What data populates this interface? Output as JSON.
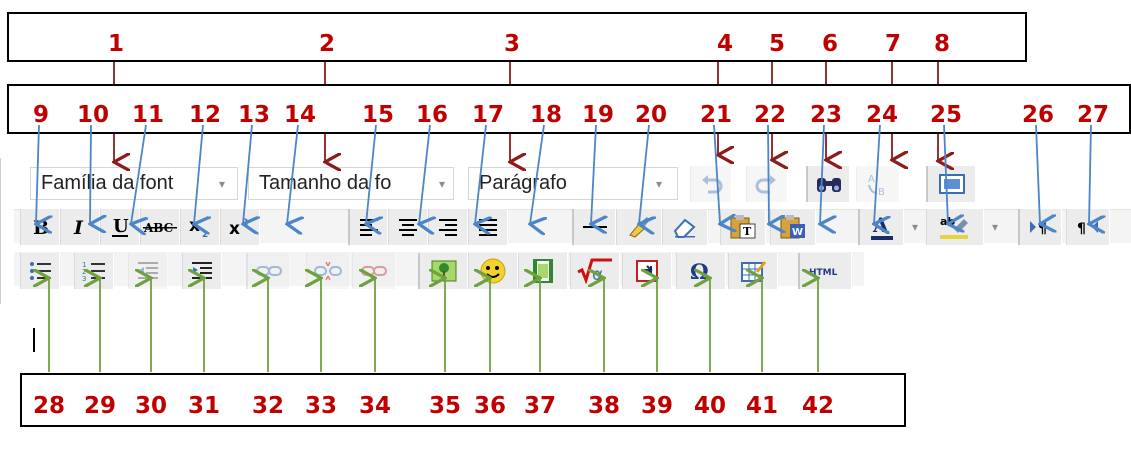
{
  "toolbar": {
    "font_family_label": "Família da font",
    "font_size_label": "Tamanho da fo",
    "paragraph_label": "Parágrafo",
    "dropdown_arrow": "▾",
    "html_button_label": "HTML"
  },
  "annotations": {
    "top_row": [
      "1",
      "2",
      "3",
      "4",
      "5",
      "6",
      "7",
      "8"
    ],
    "middle_row": [
      "9",
      "10",
      "11",
      "12",
      "13",
      "14",
      "15",
      "16",
      "17",
      "18",
      "19",
      "20",
      "21",
      "22",
      "23",
      "24",
      "25",
      "26",
      "27"
    ],
    "bottom_row": [
      "28",
      "29",
      "30",
      "31",
      "32",
      "33",
      "34",
      "35",
      "36",
      "37",
      "38",
      "39",
      "40",
      "41",
      "42"
    ]
  },
  "colors": {
    "number_color": "#c00000",
    "top_arrow_color": "#8b1c1c",
    "middle_arrow_color": "#4a86c8",
    "bottom_arrow_color": "#6fa13f"
  },
  "icons": {
    "row2": [
      "bold-icon",
      "italic-icon",
      "underline-icon",
      "strikethrough-icon",
      "subscript-icon",
      "superscript-icon",
      "align-left-icon",
      "align-center-icon",
      "align-right-icon",
      "justify-icon",
      "horizontal-rule-icon",
      "clean-format-icon",
      "eraser-icon",
      "paste-text-icon",
      "paste-word-icon",
      "font-color-icon",
      "highlight-color-icon",
      "ltr-icon",
      "rtl-icon"
    ],
    "row3": [
      "bullet-list-icon",
      "numbered-list-icon",
      "outdent-icon",
      "indent-icon",
      "link-icon",
      "unlink-icon",
      "anchor-icon",
      "image-icon",
      "emoticon-icon",
      "media-icon",
      "equation-icon",
      "nonbreaking-space-icon",
      "special-char-icon",
      "table-icon",
      "html-icon"
    ]
  }
}
